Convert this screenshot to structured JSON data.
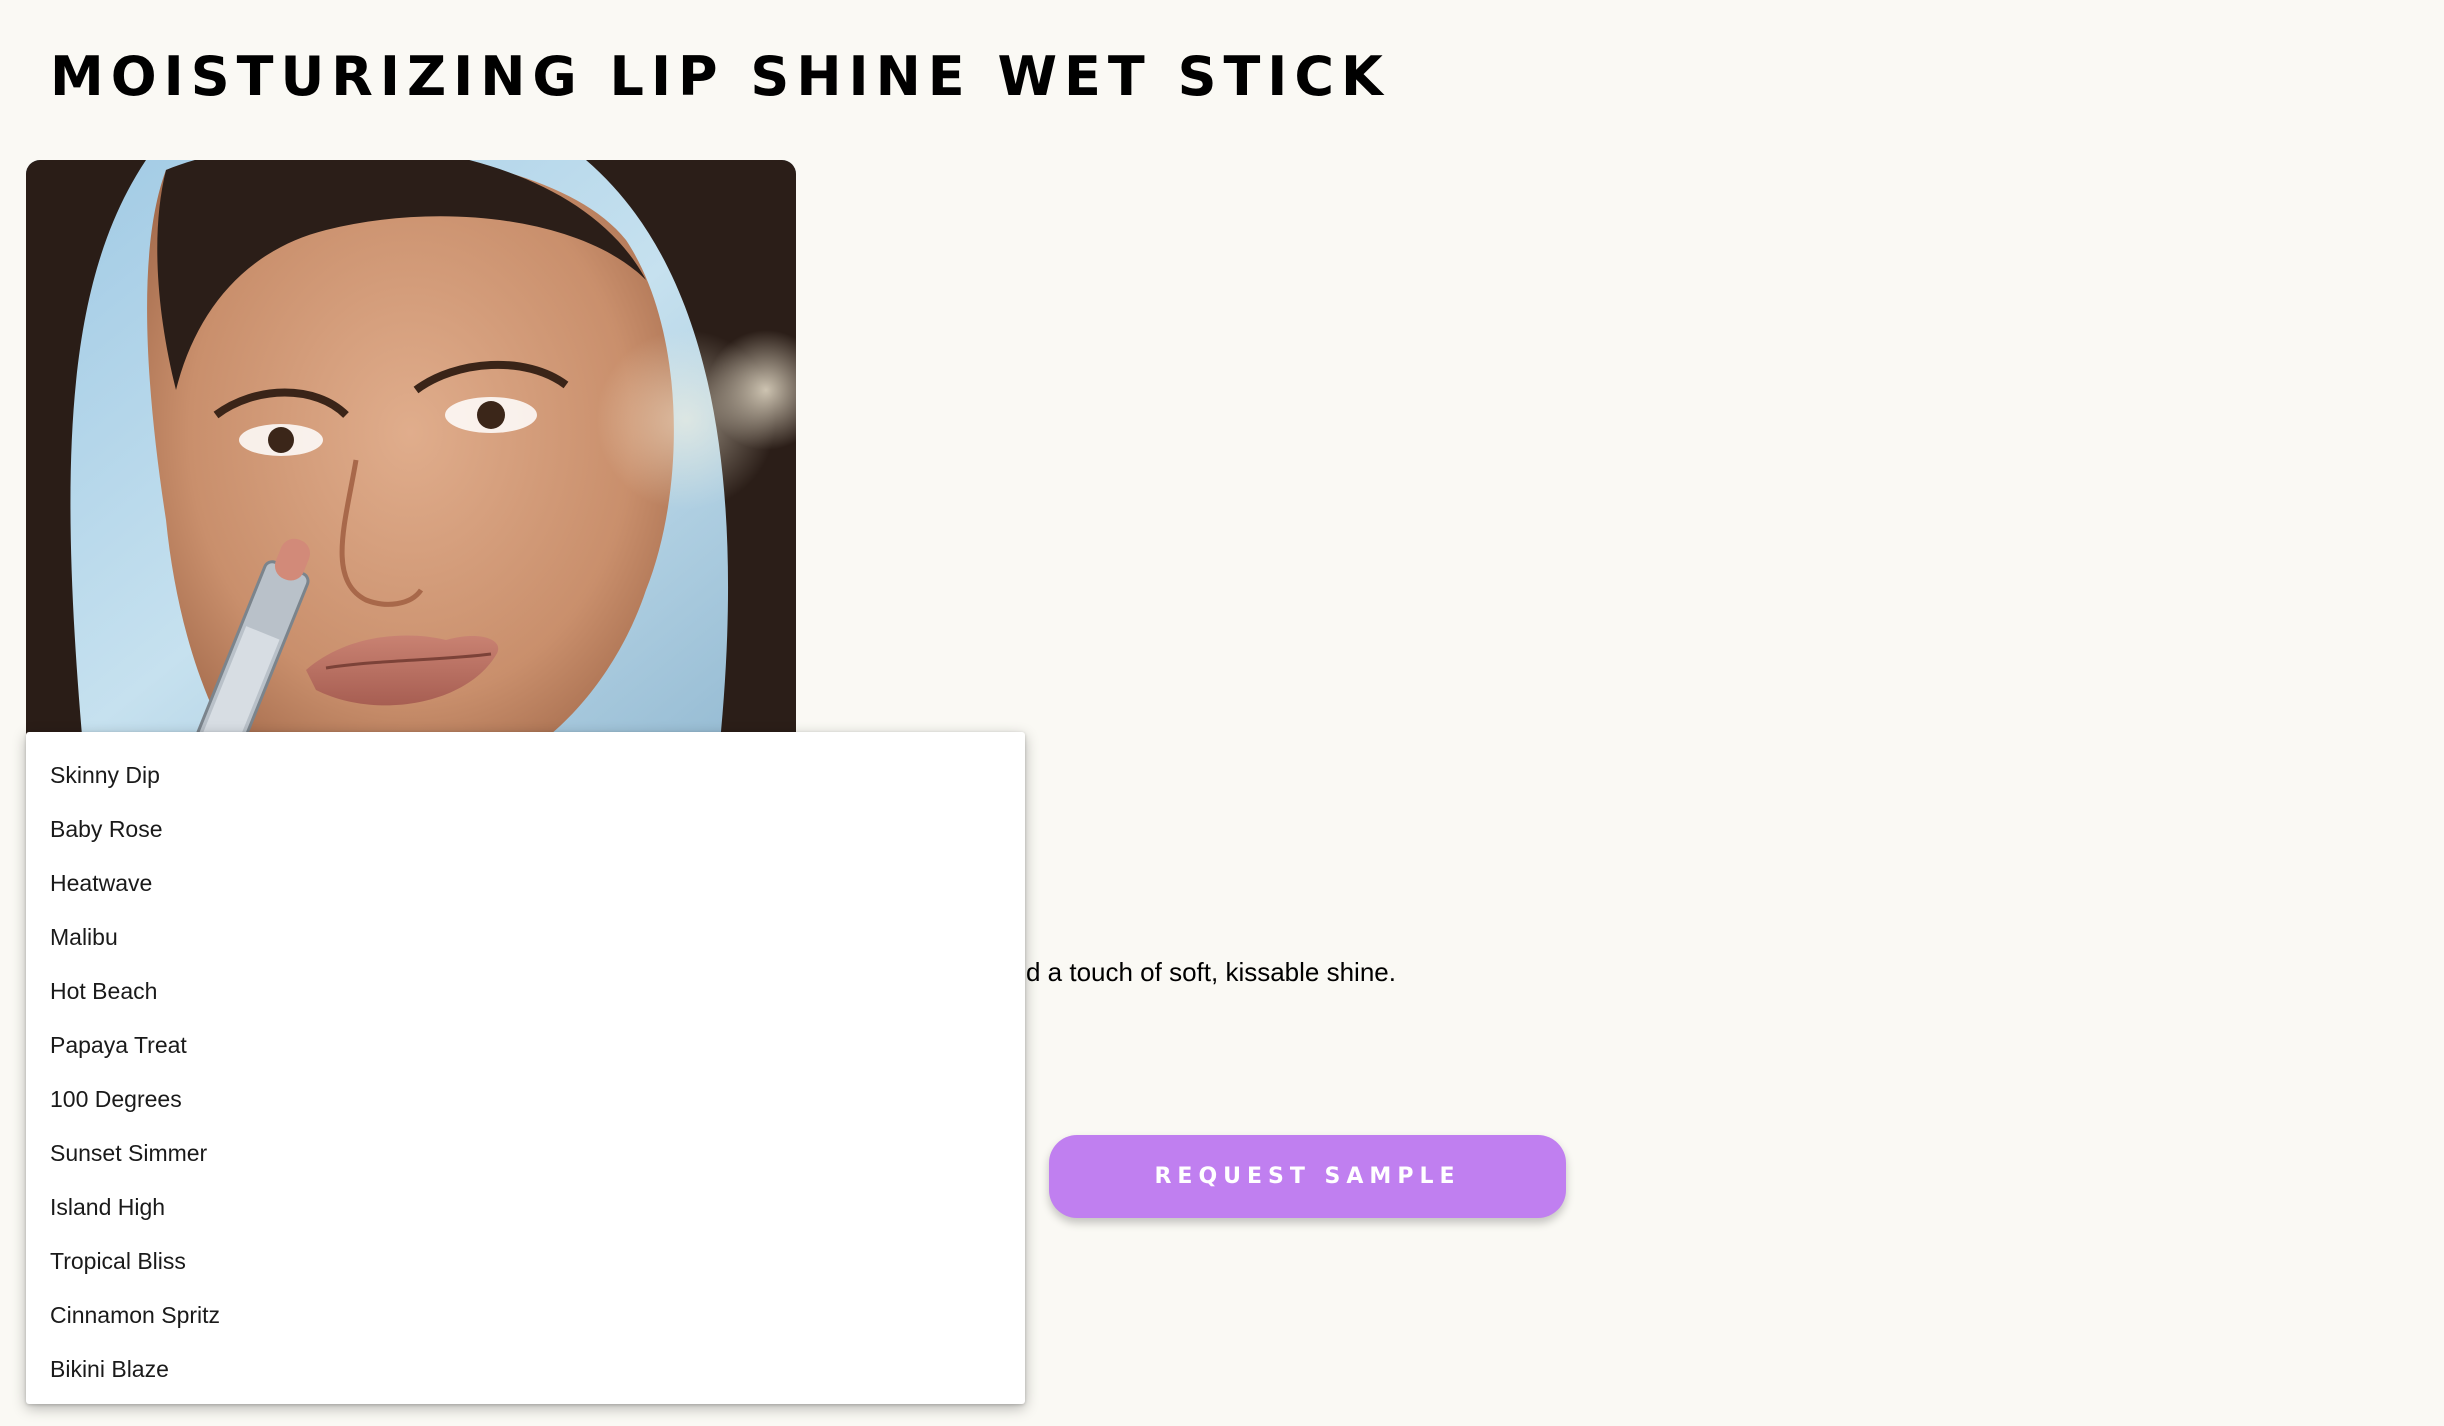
{
  "product": {
    "title": "MOISTURIZING LIP SHINE WET STICK",
    "description": "Hydrating lip balm stick with ceramides that melts onto lips for a sheer wash of color and a touch of soft, kissable shine.",
    "image_alt": "Model holding lipstick near lips"
  },
  "shade_dropdown": {
    "options": [
      "Skinny Dip",
      "Baby Rose",
      "Heatwave",
      "Malibu",
      "Hot Beach",
      "Papaya Treat",
      "100 Degrees",
      "Sunset Simmer",
      "Island High",
      "Tropical Bliss",
      "Cinnamon Spritz",
      "Bikini Blaze"
    ]
  },
  "actions": {
    "request_sample_label": "REQUEST SAMPLE"
  },
  "colors": {
    "page_background": "#faf9f4",
    "button_background": "#c07ff0",
    "button_text": "#ffffff"
  }
}
